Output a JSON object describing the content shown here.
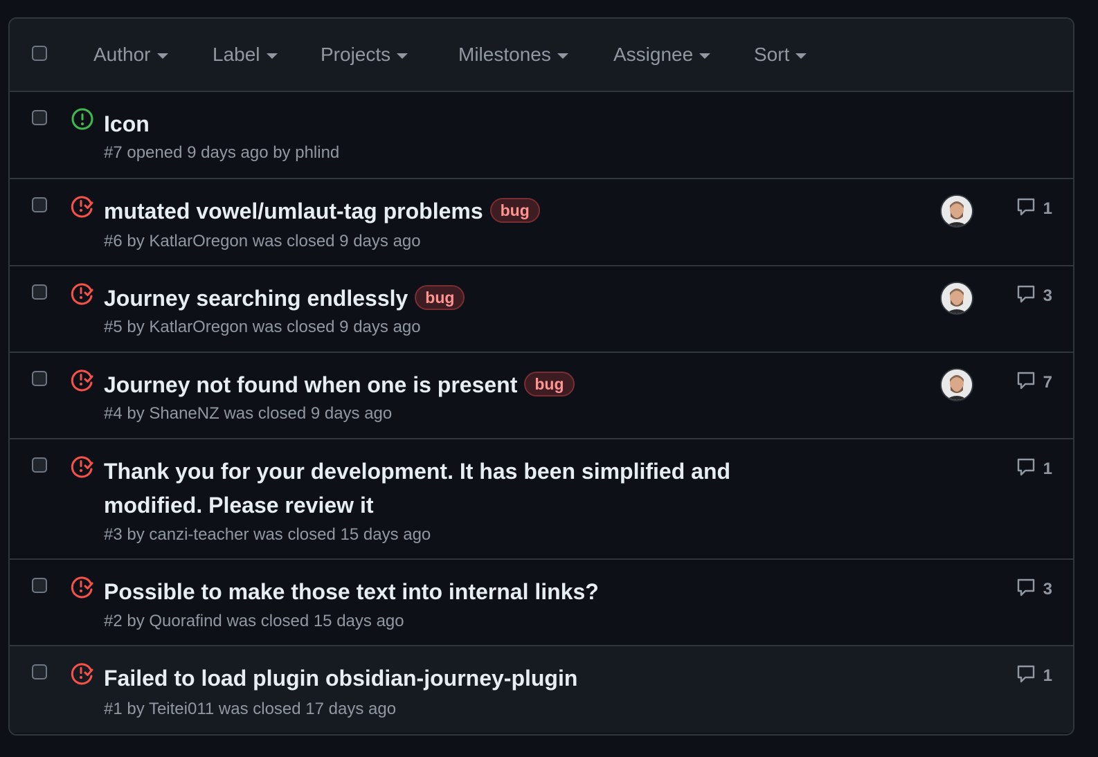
{
  "filters": [
    "Author",
    "Label",
    "Projects",
    "Milestones",
    "Assignee",
    "Sort"
  ],
  "issues": [
    {
      "title": "Icon",
      "meta": "#7 opened 9 days ago by phlind",
      "state": "open",
      "label": "",
      "avatar": false,
      "comments": ""
    },
    {
      "title": "mutated vowel/umlaut-tag problems",
      "meta": "#6 by KatlarOregon was closed 9 days ago",
      "state": "closed",
      "label": "bug",
      "avatar": true,
      "comments": "1"
    },
    {
      "title": "Journey searching endlessly",
      "meta": "#5 by KatlarOregon was closed 9 days ago",
      "state": "closed",
      "label": "bug",
      "avatar": true,
      "comments": "3"
    },
    {
      "title": "Journey not found when one is present",
      "meta": "#4 by ShaneNZ was closed 9 days ago",
      "state": "closed",
      "label": "bug",
      "avatar": true,
      "comments": "7"
    },
    {
      "title": "Thank you for your development. It has been simplified and modified. Please review it",
      "meta": "#3 by canzi-teacher was closed 15 days ago",
      "state": "closed",
      "label": "",
      "avatar": false,
      "comments": "1"
    },
    {
      "title": "Possible to make those text into internal links?",
      "meta": "#2 by Quorafind was closed 15 days ago",
      "state": "closed",
      "label": "",
      "avatar": false,
      "comments": "3"
    },
    {
      "title": "Failed to load plugin obsidian-journey-plugin",
      "meta": "#1 by Teitei011 was closed 17 days ago",
      "state": "closed",
      "label": "",
      "avatar": false,
      "comments": "1"
    }
  ],
  "colors": {
    "open": "#3fb950",
    "closed": "#f85149",
    "label": "#ff9492"
  }
}
